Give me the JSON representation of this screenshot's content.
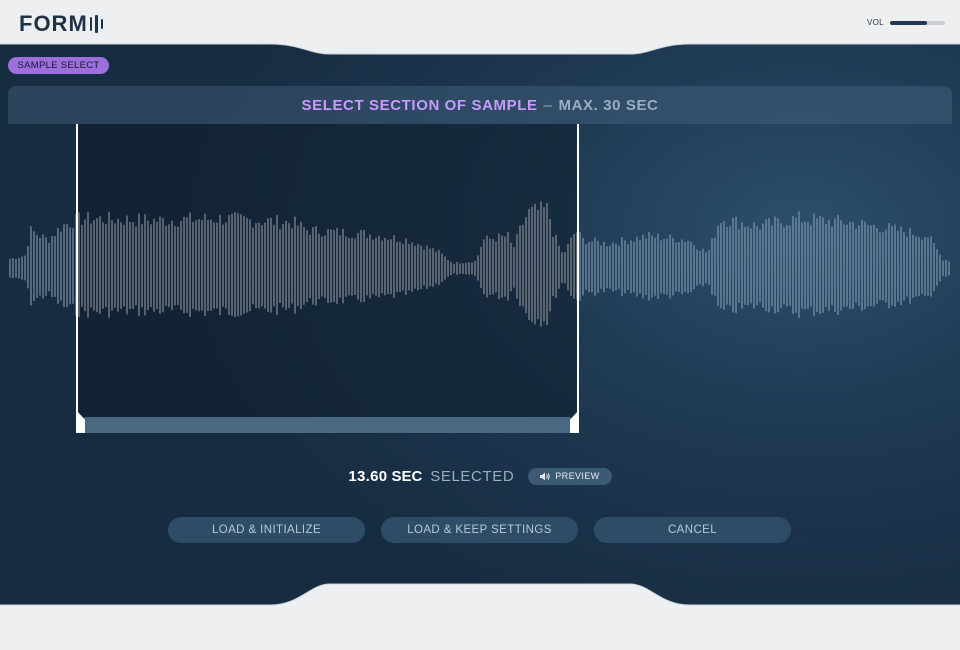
{
  "app": {
    "logo_text": "FORM",
    "volume_label": "VOL",
    "volume_level": 0.68
  },
  "section": {
    "pill_label": "SAMPLE SELECT"
  },
  "header": {
    "title": "SELECT SECTION OF SAMPLE",
    "separator": "–",
    "subtitle": "MAX. 30 SEC"
  },
  "status": {
    "value": "13.60",
    "unit": "SEC",
    "word": "SELECTED",
    "preview_label": "PREVIEW"
  },
  "actions": {
    "load_initialize": "LOAD & INITIALIZE",
    "load_keep": "LOAD & KEEP SETTINGS",
    "cancel": "CANCEL"
  },
  "colors": {
    "accent_purple": "#9c6fdc",
    "header_text": "#c89cff",
    "waveform_selected": "#ffffff",
    "waveform_unselected": "#8aa2b8"
  },
  "icons": {
    "preview": "speaker-icon"
  }
}
